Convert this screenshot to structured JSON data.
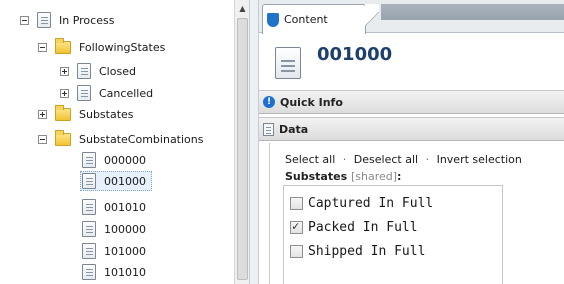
{
  "tree": {
    "items": [
      {
        "label": "In Process",
        "icon": "doc-icon",
        "expander": "minus"
      },
      {
        "label": "FollowingStates",
        "icon": "folder-icon",
        "expander": "minus"
      },
      {
        "label": "Closed",
        "icon": "doc-icon",
        "expander": "plus"
      },
      {
        "label": "Cancelled",
        "icon": "doc-icon",
        "expander": "plus"
      },
      {
        "label": "Substates",
        "icon": "folder-icon",
        "expander": "plus"
      },
      {
        "label": "SubstateCombinations",
        "icon": "folder-icon",
        "expander": "minus"
      },
      {
        "label": "000000",
        "icon": "doc-icon",
        "expander": "none"
      },
      {
        "label": "001000",
        "icon": "doc-icon",
        "expander": "none",
        "selected": true
      },
      {
        "label": "001010",
        "icon": "doc-icon",
        "expander": "none"
      },
      {
        "label": "100000",
        "icon": "doc-icon",
        "expander": "none"
      },
      {
        "label": "101000",
        "icon": "doc-icon",
        "expander": "none"
      },
      {
        "label": "101010",
        "icon": "doc-icon",
        "expander": "none"
      }
    ]
  },
  "tabs": {
    "content_label": "Content"
  },
  "header": {
    "title": "001000"
  },
  "sections": {
    "quick_info": "Quick Info",
    "data": "Data"
  },
  "selection_links": {
    "select_all": "Select all",
    "deselect_all": "Deselect all",
    "invert_selection": "Invert selection",
    "separator": "·"
  },
  "substates": {
    "label": "Substates",
    "shared": "[shared]",
    "colon": ":",
    "options": [
      {
        "label": "Captured In Full",
        "checked": false
      },
      {
        "label": "Packed In Full",
        "checked": true
      },
      {
        "label": "Shipped In Full",
        "checked": false
      }
    ]
  },
  "colors": {
    "title": "#1d3f6e",
    "accent": "#1f6fd1",
    "folder": "#f1c232"
  }
}
